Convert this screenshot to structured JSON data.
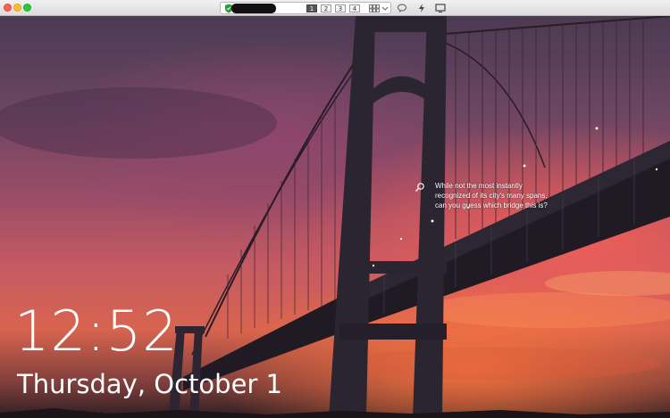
{
  "toolbar": {
    "screens": [
      "1",
      "2",
      "3",
      "4"
    ],
    "active_screen": "1"
  },
  "lock": {
    "time": "12:52",
    "date": "Thursday, October 1",
    "spotlight_caption": "While not the most instantly recognized of its city's many spans, can you guess which bridge this is?"
  },
  "icons": [
    "shield-icon",
    "grid-icon",
    "chevron-down-icon",
    "chat-icon",
    "lightning-icon",
    "monitor-icon",
    "search-icon"
  ],
  "colors": {
    "sky_top": "#4b3a52",
    "sky_mid": "#c45a63",
    "sunset": "#d8644f",
    "text": "#ffffff"
  }
}
